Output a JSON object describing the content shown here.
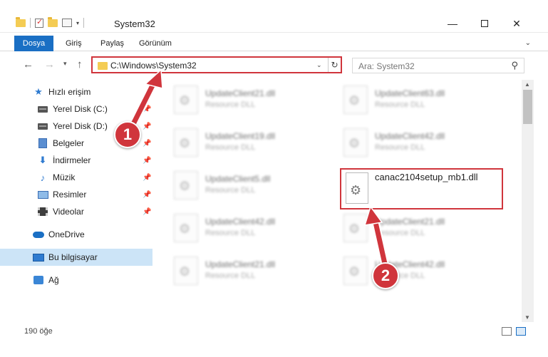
{
  "window": {
    "title": "System32",
    "minimize": "—",
    "close": "✕"
  },
  "ribbon": {
    "tabs": [
      "Dosya",
      "Giriş",
      "Paylaş",
      "Görünüm"
    ]
  },
  "navigation": {
    "address_path": "C:\\Windows\\System32",
    "search_placeholder": "Ara: System32"
  },
  "sidebar": {
    "items": [
      {
        "label": "Hızlı erişim",
        "icon": "star-icon",
        "pinned": false
      },
      {
        "label": "Yerel Disk (C:)",
        "icon": "drive-icon",
        "pinned": true
      },
      {
        "label": "Yerel Disk (D:)",
        "icon": "drive-icon",
        "pinned": true
      },
      {
        "label": "Belgeler",
        "icon": "documents-icon",
        "pinned": true
      },
      {
        "label": "İndirmeler",
        "icon": "download-icon",
        "pinned": true
      },
      {
        "label": "Müzik",
        "icon": "music-icon",
        "pinned": true
      },
      {
        "label": "Resimler",
        "icon": "pictures-icon",
        "pinned": true
      },
      {
        "label": "Videolar",
        "icon": "video-icon",
        "pinned": true
      },
      {
        "label": "OneDrive",
        "icon": "cloud-icon",
        "pinned": false
      },
      {
        "label": "Bu bilgisayar",
        "icon": "computer-icon",
        "pinned": false,
        "selected": true
      },
      {
        "label": "Ağ",
        "icon": "network-icon",
        "pinned": false
      }
    ]
  },
  "files": [
    {
      "name": "UpdateClient21.dll",
      "type": "Resource DLL"
    },
    {
      "name": "UpdateClient63.dll",
      "type": "Resource DLL"
    },
    {
      "name": "UpdateClient19.dll",
      "type": "Resource DLL"
    },
    {
      "name": "UpdateClient42.dll",
      "type": "Resource DLL"
    },
    {
      "name": "UpdateClient5.dll",
      "type": "Resource DLL"
    },
    {
      "name": "UpdateClient42.dll",
      "type": "Resource DLL"
    },
    {
      "name": "UpdateClient21.dll",
      "type": "Resource DLL"
    },
    {
      "name": "UpdateClient21.dll",
      "type": "Resource DLL"
    },
    {
      "name": "UpdateClient42.dll",
      "type": "Resource DLL"
    }
  ],
  "highlighted_file": {
    "name": "canac2104setup_mb1.dll"
  },
  "status": {
    "item_count": "190 öğe"
  },
  "callouts": [
    "1",
    "2"
  ],
  "colors": {
    "accent": "#1a6fc4",
    "highlight": "#d0353c",
    "selection": "#cce4f7"
  }
}
